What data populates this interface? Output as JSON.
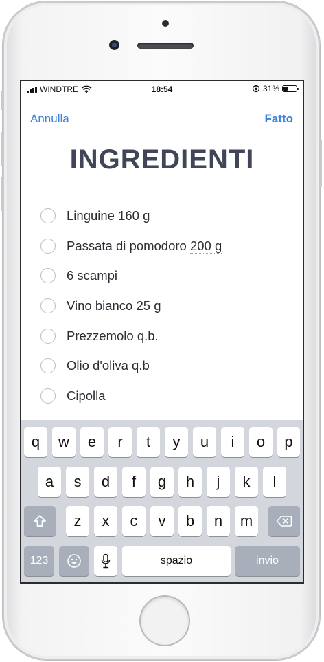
{
  "status_bar": {
    "carrier": "WINDTRE",
    "time": "18:54",
    "battery": "31%",
    "battery_level": 0.31
  },
  "nav": {
    "cancel_label": "Annulla",
    "done_label": "Fatto"
  },
  "title": "INGREDIENTI",
  "ingredients": [
    {
      "name": "Linguine",
      "qty": "160 g",
      "checked": false
    },
    {
      "name": "Passata di pomodoro",
      "qty": "200 g",
      "checked": false
    },
    {
      "name": "6 scampi",
      "qty": "",
      "checked": false
    },
    {
      "name": "Vino bianco",
      "qty": "25 g",
      "checked": false
    },
    {
      "name": "Prezzemolo q.b.",
      "qty": "",
      "checked": false
    },
    {
      "name": "Olio d'oliva q.b",
      "qty": "",
      "checked": false
    },
    {
      "name": "Cipolla",
      "qty": "",
      "checked": false
    }
  ],
  "keyboard": {
    "row1": [
      "q",
      "w",
      "e",
      "r",
      "t",
      "y",
      "u",
      "i",
      "o",
      "p"
    ],
    "row2": [
      "a",
      "s",
      "d",
      "f",
      "g",
      "h",
      "j",
      "k",
      "l"
    ],
    "row3": [
      "z",
      "x",
      "c",
      "v",
      "b",
      "n",
      "m"
    ],
    "numbers_label": "123",
    "space_label": "spazio",
    "return_label": "invio",
    "icons": {
      "shift": "shift-icon",
      "backspace": "backspace-icon",
      "emoji": "emoji-icon",
      "mic": "microphone-icon"
    }
  },
  "colors": {
    "accent": "#3b82dc",
    "title": "#404657",
    "keyboard_bg": "#d3d6dd",
    "key_dark": "#a9aebb"
  }
}
